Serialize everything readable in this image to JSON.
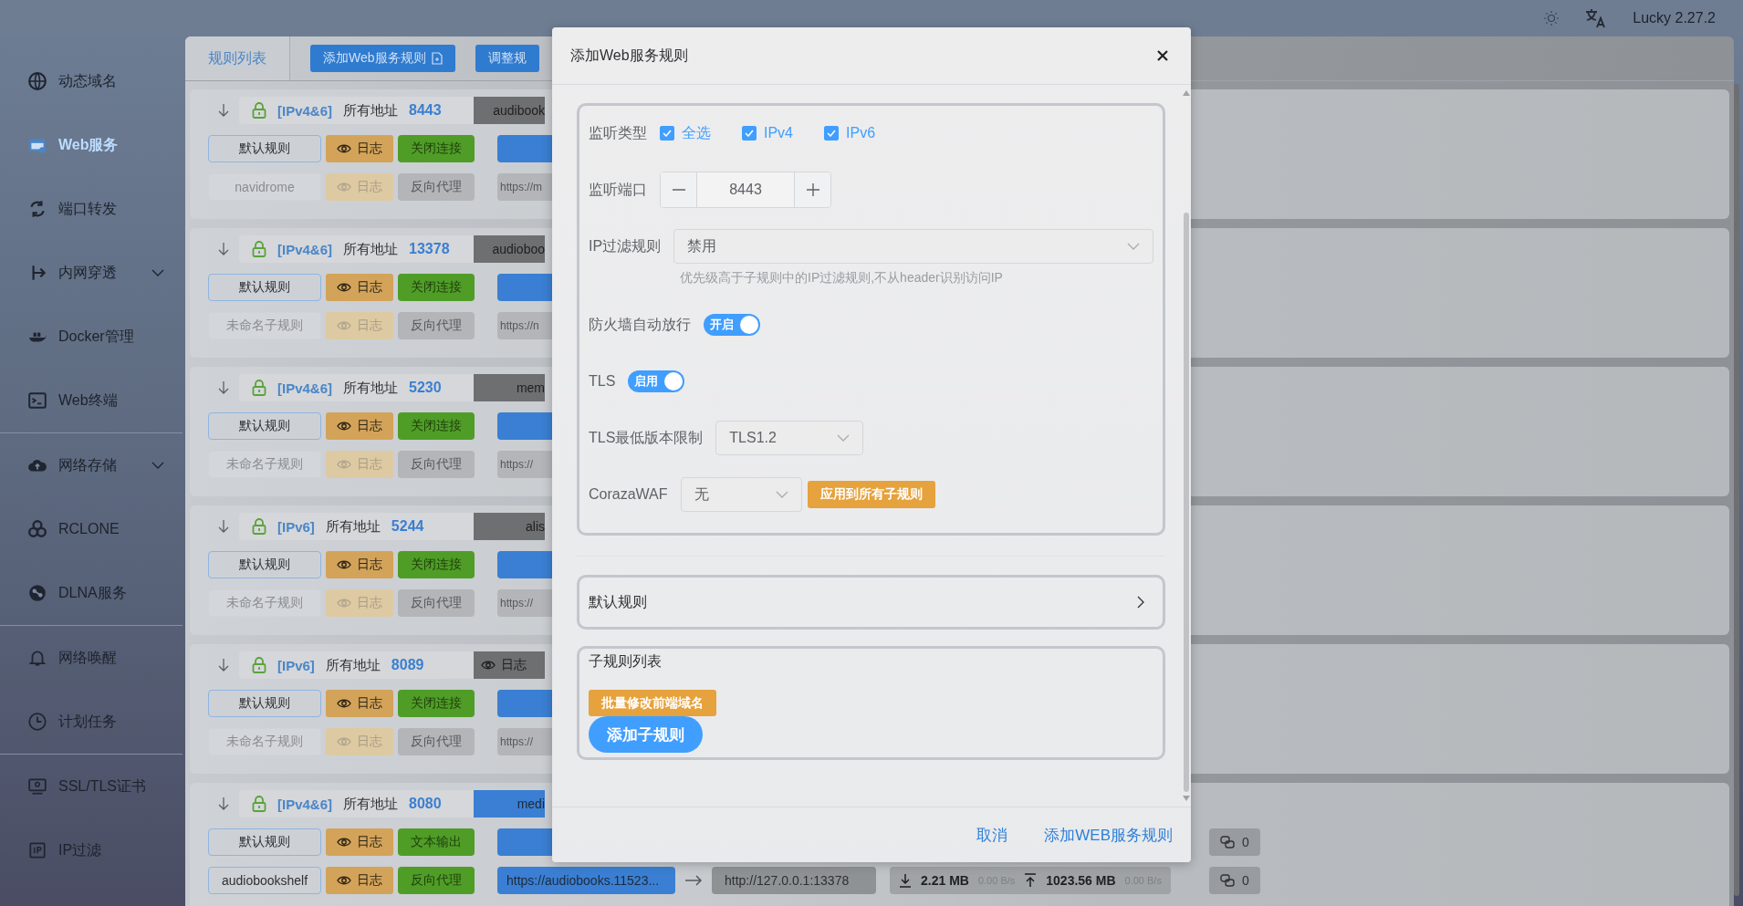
{
  "header": {
    "version": "Lucky 2.27.2"
  },
  "sidebar": {
    "sections": [
      {
        "items": [
          {
            "label": "动态域名",
            "selected": false,
            "has_submenu": false
          },
          {
            "label": "Web服务",
            "selected": true,
            "has_submenu": false
          },
          {
            "label": "端口转发",
            "selected": false,
            "has_submenu": false
          },
          {
            "label": "内网穿透",
            "selected": false,
            "has_submenu": true
          },
          {
            "label": "Docker管理",
            "selected": false,
            "has_submenu": false
          },
          {
            "label": "Web终端",
            "selected": false,
            "has_submenu": false
          }
        ]
      },
      {
        "items": [
          {
            "label": "网络存储",
            "selected": false,
            "has_submenu": true
          },
          {
            "label": "RCLONE",
            "selected": false,
            "has_submenu": false
          },
          {
            "label": "DLNA服务",
            "selected": false,
            "has_submenu": false
          }
        ]
      },
      {
        "items": [
          {
            "label": "网络唤醒",
            "selected": false,
            "has_submenu": false
          },
          {
            "label": "计划任务",
            "selected": false,
            "has_submenu": false
          }
        ]
      },
      {
        "items": [
          {
            "label": "SSL/TLS证书",
            "selected": false,
            "has_submenu": false
          },
          {
            "label": "IP过滤",
            "selected": false,
            "has_submenu": false
          }
        ]
      }
    ]
  },
  "main": {
    "tabs": [
      {
        "label": "规则列表",
        "selected": true
      }
    ],
    "toolbar": [
      {
        "label": "添加Web服务规则",
        "kind": "add"
      },
      {
        "label": "调整规",
        "kind": "plain"
      }
    ],
    "rules": [
      {
        "ip_type": "[IPv4&6]",
        "address": "所有地址",
        "port": "8443",
        "service": {
          "kind": "name",
          "label": "audibook",
          "highlighted": false
        },
        "subrules": [
          {
            "name": "默认规则",
            "enabled": true,
            "log": "日志",
            "mode": "关闭连接"
          },
          {
            "name": "navidrome",
            "enabled": false,
            "log": "日志",
            "mode": "反向代理",
            "target": "https://m"
          }
        ]
      },
      {
        "ip_type": "[IPv4&6]",
        "address": "所有地址",
        "port": "13378",
        "service": {
          "kind": "name",
          "label": "audioboo",
          "highlighted": false
        },
        "subrules": [
          {
            "name": "默认规则",
            "enabled": true,
            "log": "日志",
            "mode": "关闭连接"
          },
          {
            "name": "未命名子规则",
            "enabled": false,
            "log": "日志",
            "mode": "反向代理",
            "target": "https://n"
          }
        ]
      },
      {
        "ip_type": "[IPv4&6]",
        "address": "所有地址",
        "port": "5230",
        "service": {
          "kind": "name",
          "label": "mem",
          "highlighted": false
        },
        "subrules": [
          {
            "name": "默认规则",
            "enabled": true,
            "log": "日志",
            "mode": "关闭连接"
          },
          {
            "name": "未命名子规则",
            "enabled": false,
            "log": "日志",
            "mode": "反向代理",
            "target": "https://"
          }
        ]
      },
      {
        "ip_type": "[IPv6]",
        "address": "所有地址",
        "port": "5244",
        "service": {
          "kind": "name",
          "label": "alis",
          "highlighted": false
        },
        "subrules": [
          {
            "name": "默认规则",
            "enabled": true,
            "log": "日志",
            "mode": "关闭连接"
          },
          {
            "name": "未命名子规则",
            "enabled": false,
            "log": "日志",
            "mode": "反向代理",
            "target": "https://"
          }
        ]
      },
      {
        "ip_type": "[IPv6]",
        "address": "所有地址",
        "port": "8089",
        "service": {
          "kind": "log",
          "label": "日志",
          "highlighted": false
        },
        "subrules": [
          {
            "name": "默认规则",
            "enabled": true,
            "log": "日志",
            "mode": "关闭连接"
          },
          {
            "name": "未命名子规则",
            "enabled": false,
            "log": "日志",
            "mode": "反向代理",
            "target": "https://"
          }
        ]
      },
      {
        "ip_type": "[IPv4&6]",
        "address": "所有地址",
        "port": "8080",
        "service": {
          "kind": "name",
          "label": "medi",
          "highlighted": true
        },
        "subrules": [
          {
            "name": "默认规则",
            "enabled": true,
            "log": "日志",
            "mode": "文本输出",
            "connections": "0"
          },
          {
            "name": "audiobookshelf",
            "enabled": true,
            "log": "日志",
            "mode": "反向代理",
            "target": "https://audiobooks.11523...",
            "backend": "http://127.0.0.1:13378",
            "traffic": {
              "download": "2.21 MB",
              "download_rate": "0.00 B/s",
              "upload": "1023.56 MB",
              "upload_rate": "0.00 B/s"
            },
            "connections": "0"
          }
        ]
      }
    ]
  },
  "dialog": {
    "title": "添加Web服务规则",
    "fields": [
      {
        "kind": "checkboxes",
        "label": "监听类型",
        "options": [
          {
            "label": "全选",
            "checked": true
          },
          {
            "label": "IPv4",
            "checked": true
          },
          {
            "label": "IPv6",
            "checked": true
          }
        ]
      },
      {
        "kind": "stepper",
        "label": "监听端口",
        "value": "8443"
      },
      {
        "kind": "select",
        "label": "IP过滤规则",
        "value": "禁用",
        "wide": true,
        "hint": "优先级高于子规则中的IP过滤规则,不从header识别访问IP"
      },
      {
        "kind": "switch",
        "label": "防火墙自动放行",
        "on": true,
        "text": "开启"
      },
      {
        "kind": "switch",
        "label": "TLS",
        "on": true,
        "text": "启用"
      },
      {
        "kind": "select",
        "label": "TLS最低版本限制",
        "value": "TLS1.2"
      },
      {
        "kind": "select",
        "label": "CorazaWAF",
        "value": "无",
        "action": "应用到所有子规则"
      }
    ],
    "default_rule": "默认规则",
    "subrules": {
      "title": "子规则列表",
      "batch_button": "批量修改前端域名",
      "add_button": "添加子规则"
    },
    "buttons": [
      {
        "label": "取消"
      },
      {
        "label": "添加WEB服务规则"
      }
    ]
  }
}
